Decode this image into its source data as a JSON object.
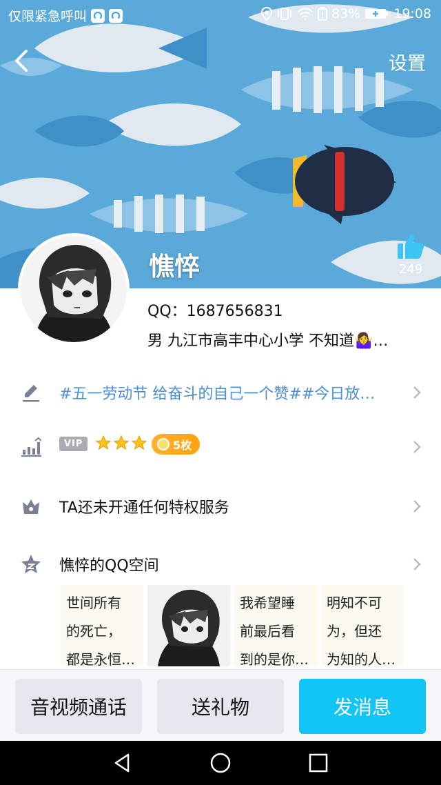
{
  "status_bar": {
    "left_text": "仅限紧急呼叫",
    "battery": "83%",
    "time": "19:08"
  },
  "header": {
    "settings_label": "设置",
    "like_count": "249",
    "nickname": "憔悴"
  },
  "profile": {
    "qq_line": "QQ：1687656831",
    "info_line": "男  九江市高丰中心小学  不知道🤷‍♀️…"
  },
  "rows": {
    "signature": "#五一劳动节 给奋斗的自己一个赞##今日放…",
    "vip_tag": "VIP",
    "medal_badge": "5枚",
    "privilege": "TA还未开通任何特权服务",
    "qzone_title": "憔悴的QQ空间"
  },
  "qzone_cards": [
    {
      "lines": [
        "世间所有",
        "的死亡，",
        "都是永恒…"
      ]
    },
    {
      "lines": [
        "我希望睡",
        "前最后看",
        "到的是你…"
      ]
    },
    {
      "lines": [
        "明知不可",
        "为，但还",
        "为知的人…"
      ]
    }
  ],
  "actions": {
    "call": "音视频通话",
    "gift": "送礼物",
    "message": "发消息"
  },
  "colors": {
    "accent_blue": "#12c5f7",
    "signature_blue": "#4a8fd8",
    "medal_orange": "#ffa313"
  }
}
